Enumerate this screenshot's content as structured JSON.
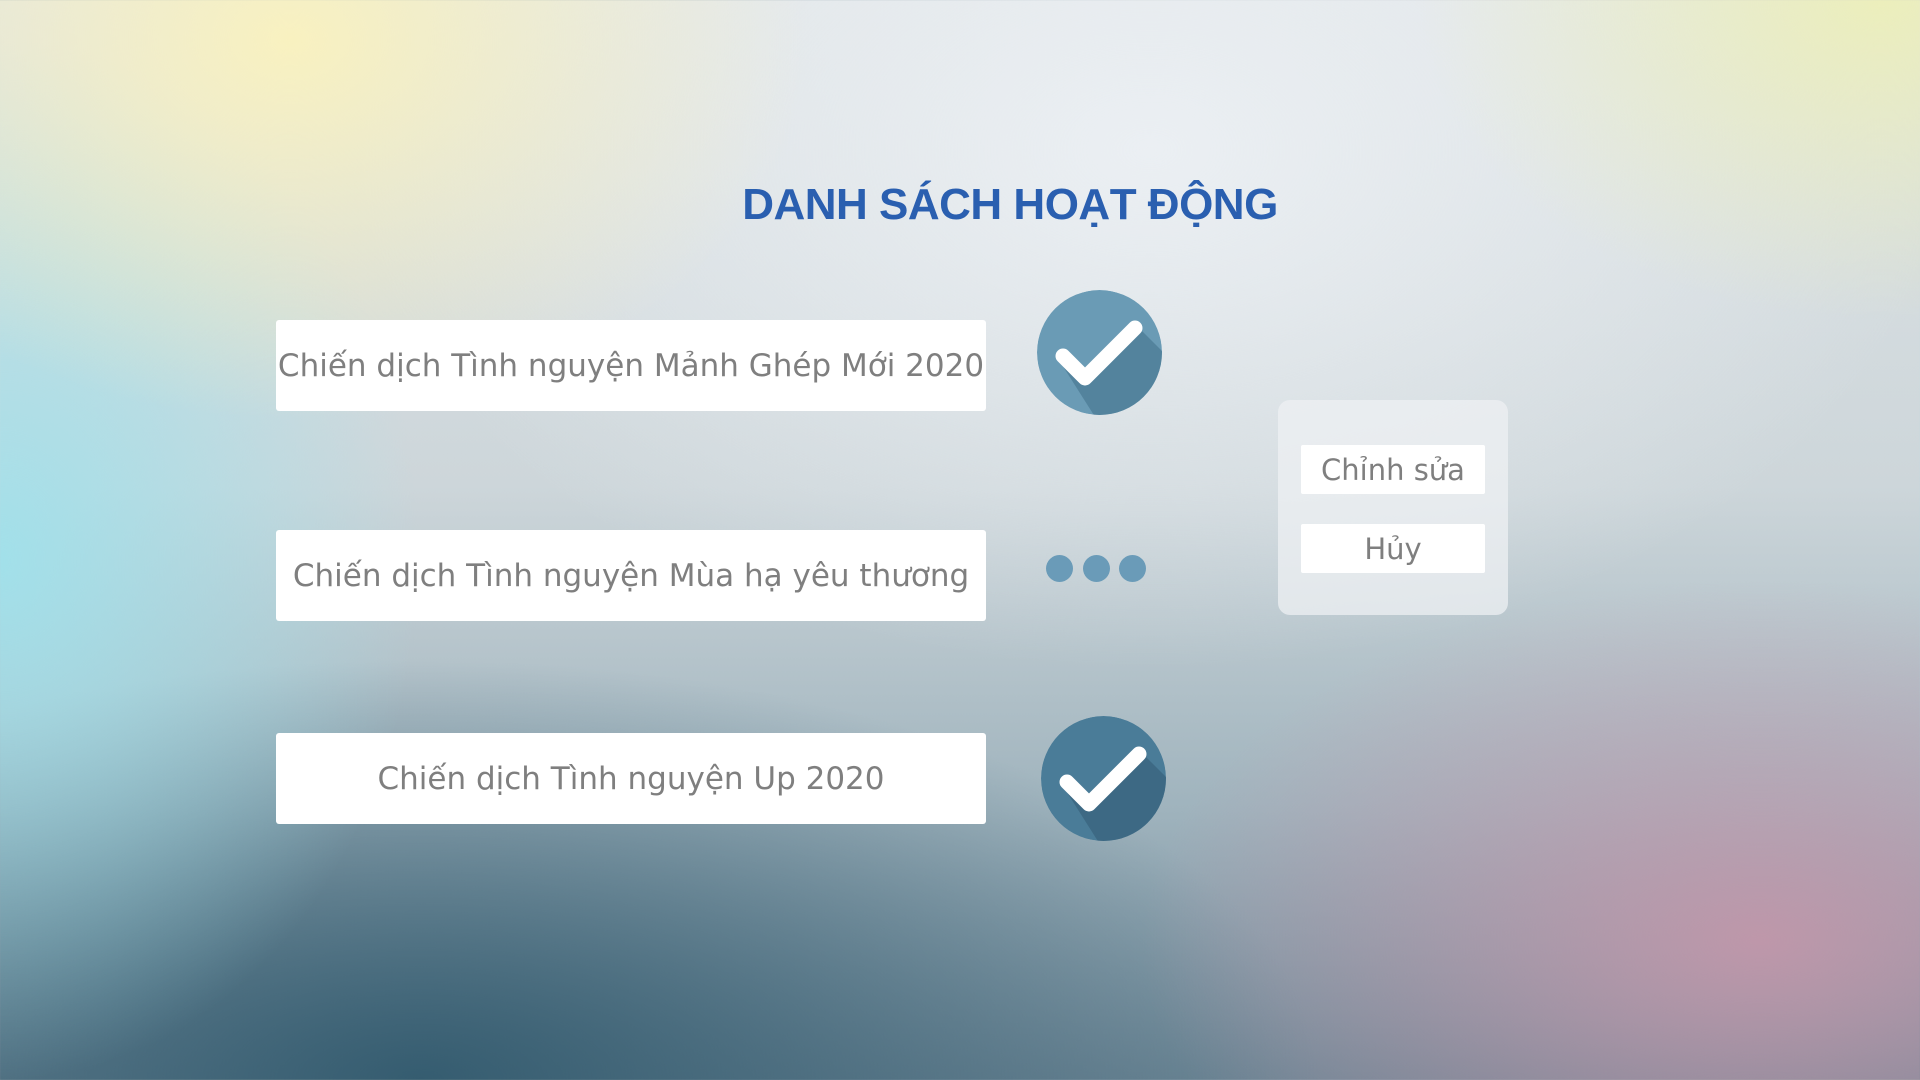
{
  "title": "DANH SÁCH HOẠT ĐỘNG",
  "activities": [
    {
      "label": "Chiến dịch Tình nguyện Mảnh Ghép Mới 2020",
      "status": "check-icon"
    },
    {
      "label": "Chiến dịch Tình nguyện Mùa hạ yêu thương",
      "status": "more-icon"
    },
    {
      "label": "Chiến dịch Tình nguyện Up 2020",
      "status": "check-icon"
    }
  ],
  "menu": {
    "edit_label": "Chỉnh sửa",
    "cancel_label": "Hủy"
  },
  "colors": {
    "title": "#2a5fb0",
    "check_light": "#6a9bb5",
    "check_dark": "#4a7c98",
    "dots": "#6a9bb8",
    "text": "#7f7f7f"
  }
}
